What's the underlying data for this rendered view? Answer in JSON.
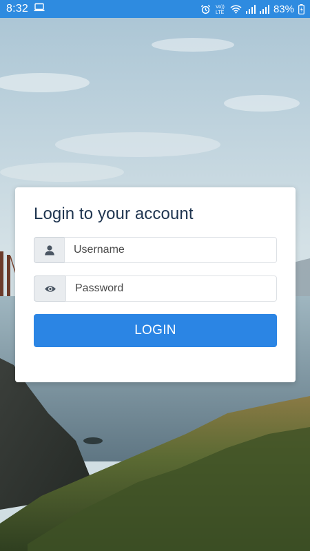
{
  "status_bar": {
    "time": "8:32",
    "battery_percent": "83%",
    "icons": [
      "laptop-icon",
      "alarm-icon",
      "volte-icon",
      "wifi-icon",
      "signal-icon",
      "signal-icon",
      "battery-charging-icon"
    ],
    "network_label": "Vo)) LTE"
  },
  "login": {
    "title": "Login to your account",
    "username": {
      "placeholder": "Username",
      "value": "",
      "icon": "user-icon"
    },
    "password": {
      "placeholder": "Password",
      "value": "",
      "icon": "eye-icon"
    },
    "button_label": "LOGIN"
  },
  "colors": {
    "status_bar": "#2e8be0",
    "accent": "#2b85e4",
    "title_text": "#1f3550",
    "addon_bg": "#e9ecef"
  }
}
